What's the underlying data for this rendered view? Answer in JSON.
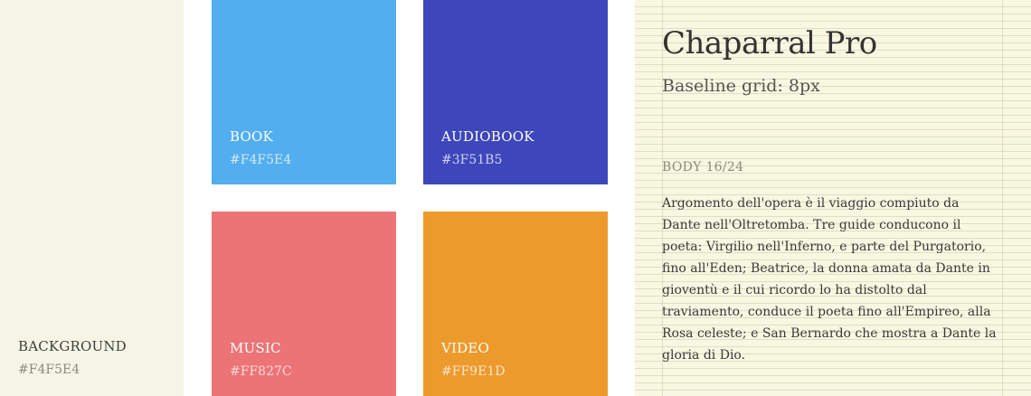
{
  "background": {
    "label": "BACKGROUND",
    "hex": "#F4F5E4",
    "color": "#F4F5E4"
  },
  "swatches": [
    {
      "label": "BOOK",
      "hex": "#F4F5E4",
      "color": "#52AEEF"
    },
    {
      "label": "AUDIOBOOK",
      "hex": "#3F51B5",
      "color": "#3D47BB"
    },
    {
      "label": "MUSIC",
      "hex": "#FF827C",
      "color": "#EC7476"
    },
    {
      "label": "VIDEO",
      "hex": "#FF9E1D",
      "color": "#ED9A2C"
    }
  ],
  "typography": {
    "font_name": "Chaparral Pro",
    "grid_note": "Baseline grid: 8px",
    "spec": "BODY 16/24",
    "body": "Argomento dell'opera è il viaggio compiuto da Dante nell'Oltretomba. Tre guide conducono il poeta: Virgilio nell'Inferno, e parte del Purgatorio, fino all'Eden; Beatrice, la donna amata da Dante in gioventù e il cui ricordo lo ha distolto dal traviamento, conduce il poeta fino all'Empireo, alla Rosa celeste; e San Bernardo che mostra a Dante la gloria di Dio."
  }
}
